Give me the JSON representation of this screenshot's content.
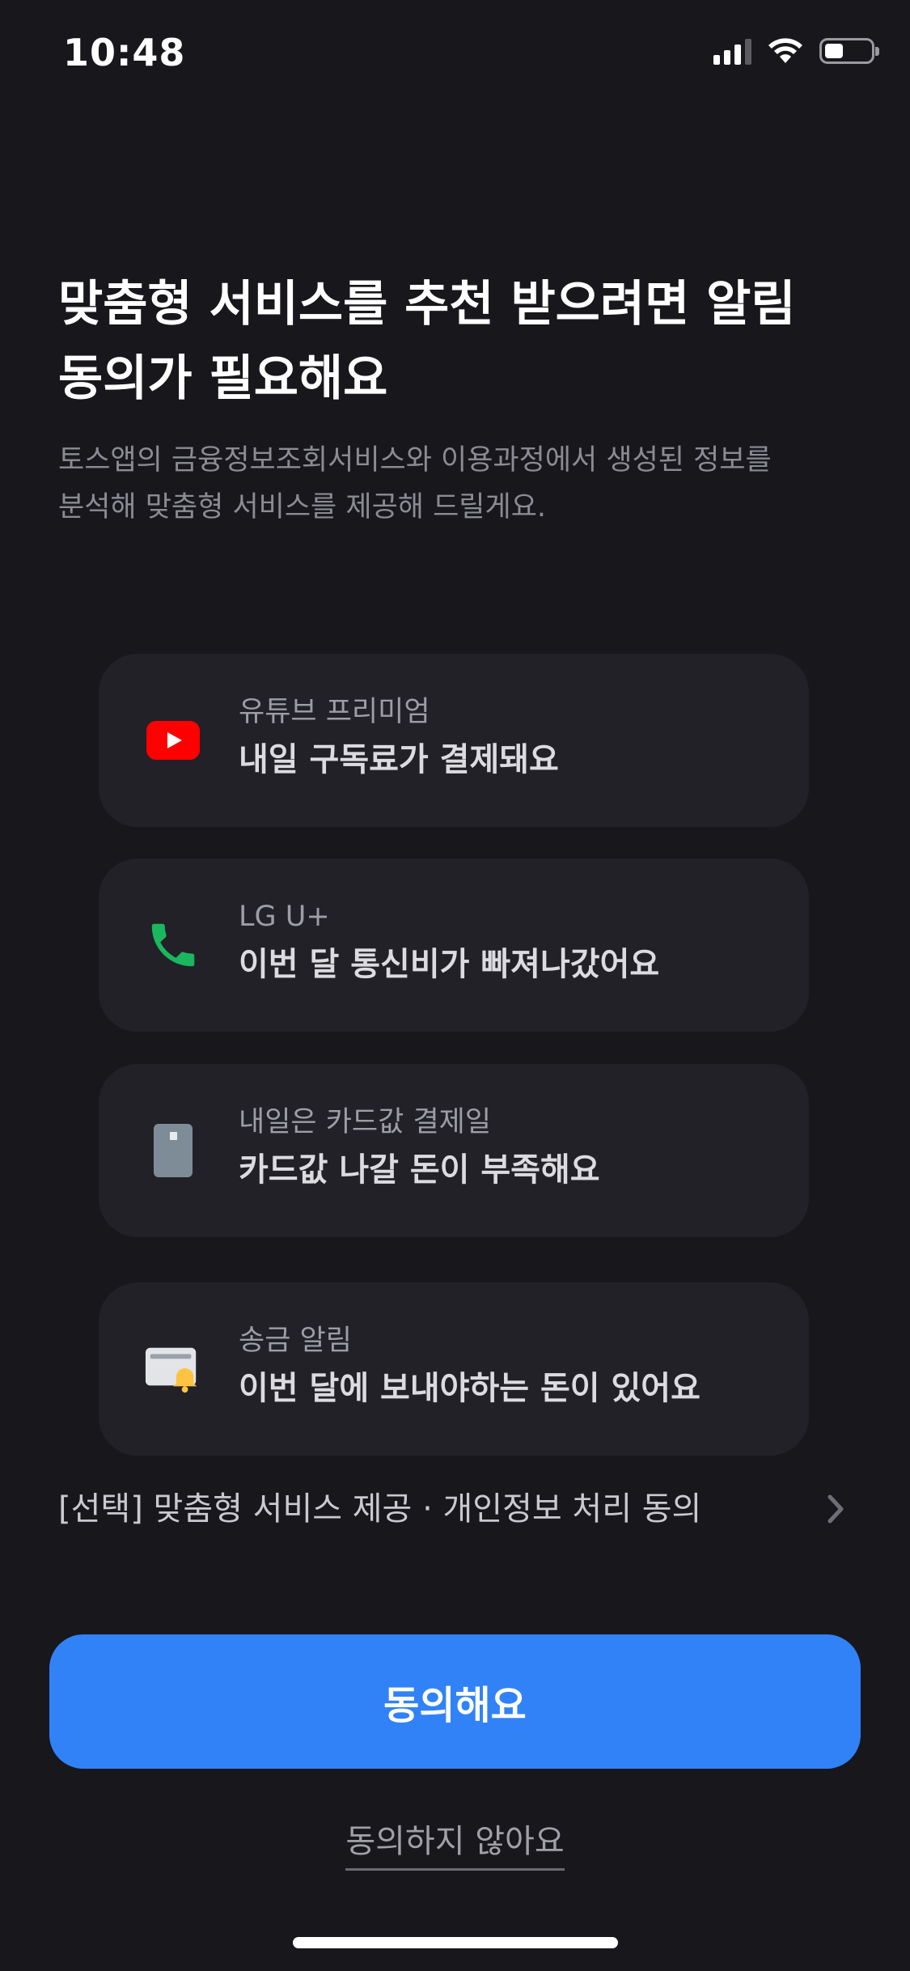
{
  "status_bar": {
    "time": "10:48",
    "icons": [
      "cellular-signal-icon",
      "wifi-icon",
      "battery-icon"
    ]
  },
  "header": {
    "title_line1": "맞춤형 서비스를 추천 받으려면 알림",
    "title_line2": "동의가 필요해요",
    "subtitle_line1": "토스앱의 금융정보조회서비스와 이용과정에서 생성된 정보를",
    "subtitle_line2": "분석해 맞춤형 서비스를 제공해 드릴게요."
  },
  "cards": [
    {
      "icon": "youtube-icon",
      "label": "유튜브 프리미엄",
      "message": "내일 구독료가 결제돼요"
    },
    {
      "icon": "phone-icon",
      "label": "LG U+",
      "message": "이번 달 통신비가 빠져나갔어요"
    },
    {
      "icon": "card-icon",
      "label": "내일은 카드값 결제일",
      "message": "카드값 나갈 돈이 부족해요"
    },
    {
      "icon": "transfer-bell-icon",
      "label": "송금 알림",
      "message": "이번 달에 보내야하는 돈이 있어요"
    }
  ],
  "consent": {
    "text": "[선택] 맞춤형 서비스 제공 · 개인정보 처리 동의",
    "icon": "chevron-right-icon"
  },
  "actions": {
    "agree_label": "동의해요",
    "disagree_label": "동의하지 않아요"
  },
  "colors": {
    "background": "#17171c",
    "card_background": "#212127",
    "accent": "#3182f6",
    "youtube_red": "#ff0000",
    "phone_green": "#1ab75e"
  }
}
